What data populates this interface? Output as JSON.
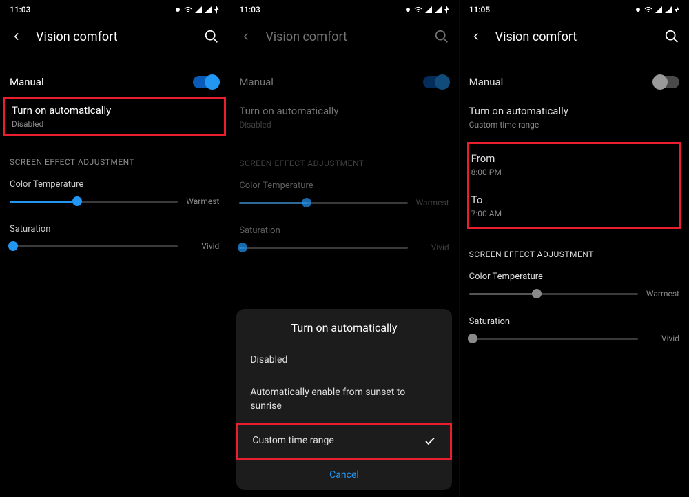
{
  "status": {
    "time1": "11:03",
    "time2": "11:03",
    "time3": "11:05",
    "icons": "⚫ ▾ ◢ ◢ ⚡"
  },
  "header": {
    "title": "Vision comfort"
  },
  "rows": {
    "manual": "Manual",
    "auto_title": "Turn on automatically",
    "auto_sub_disabled": "Disabled",
    "auto_sub_custom": "Custom time range",
    "from_label": "From",
    "from_value": "8:00 PM",
    "to_label": "To",
    "to_value": "7:00 AM"
  },
  "section": "SCREEN EFFECT ADJUSTMENT",
  "sliders": {
    "temp_label": "Color Temperature",
    "temp_end": "Warmest",
    "sat_label": "Saturation",
    "sat_end": "Vivid"
  },
  "dialog": {
    "title": "Turn on automatically",
    "opt_disabled": "Disabled",
    "opt_auto": "Automatically enable from sunset to sunrise",
    "opt_custom": "Custom time range",
    "cancel": "Cancel"
  }
}
